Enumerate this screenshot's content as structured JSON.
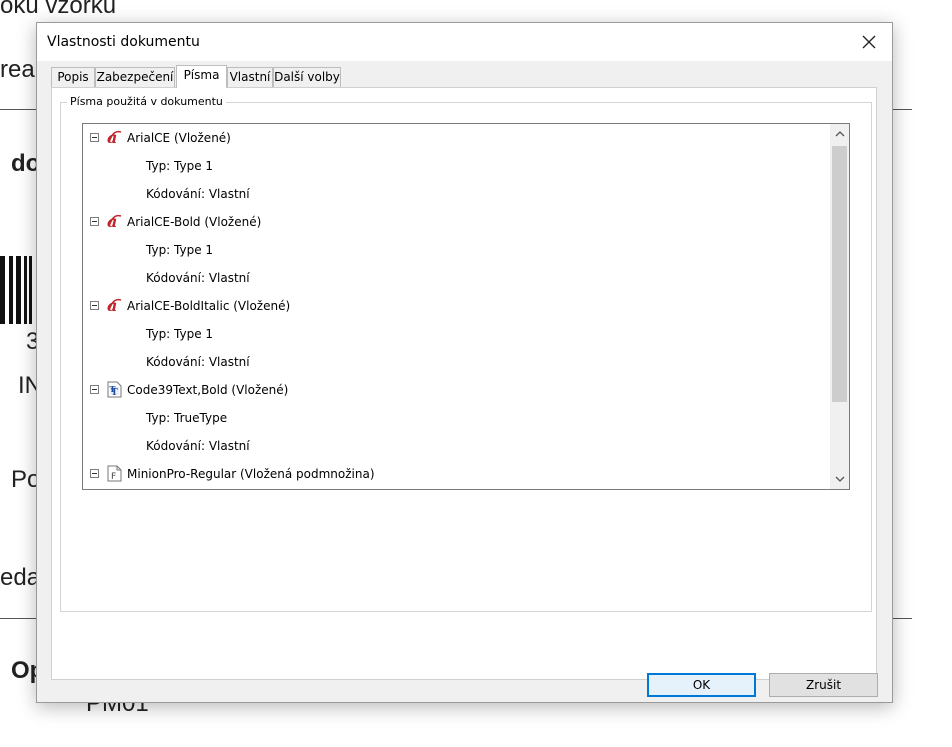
{
  "background_doc": {
    "fragments": [
      {
        "text": "oku vzorku",
        "bold": false
      },
      {
        "text": "rea",
        "bold": false
      },
      {
        "text": "do",
        "bold": true
      },
      {
        "text": "3",
        "bold": false
      },
      {
        "text": "IN",
        "bold": false
      },
      {
        "text": "Po",
        "bold": false
      },
      {
        "text": "eda",
        "bold": false
      },
      {
        "text": "Op",
        "bold": true
      },
      {
        "text": "PM01",
        "bold": false
      }
    ]
  },
  "dialog": {
    "title": "Vlastnosti dokumentu",
    "tabs": [
      {
        "label": "Popis",
        "active": false
      },
      {
        "label": "Zabezpečení",
        "active": false
      },
      {
        "label": "Písma",
        "active": true
      },
      {
        "label": "Vlastní",
        "active": false
      },
      {
        "label": "Další volby",
        "active": false
      }
    ],
    "group_label": "Písma použitá v dokumentu",
    "fonts": [
      {
        "name": "ArialCE (Vložené)",
        "icon": "opentype-font-icon",
        "type": "Typ: Type 1",
        "encoding": "Kódování: Vlastní"
      },
      {
        "name": "ArialCE-Bold (Vložené)",
        "icon": "opentype-font-icon",
        "type": "Typ: Type 1",
        "encoding": "Kódování: Vlastní"
      },
      {
        "name": "ArialCE-BoldItalic (Vložené)",
        "icon": "opentype-font-icon",
        "type": "Typ: Type 1",
        "encoding": "Kódování: Vlastní"
      },
      {
        "name": "Code39Text,Bold (Vložené)",
        "icon": "truetype-font-icon",
        "type": "Typ: TrueType",
        "encoding": "Kódování: Vlastní"
      },
      {
        "name": "MinionPro-Regular (Vložená podmnožina)",
        "icon": "font-file-icon"
      }
    ],
    "buttons": {
      "ok": "OK",
      "cancel": "Zrušit"
    }
  }
}
